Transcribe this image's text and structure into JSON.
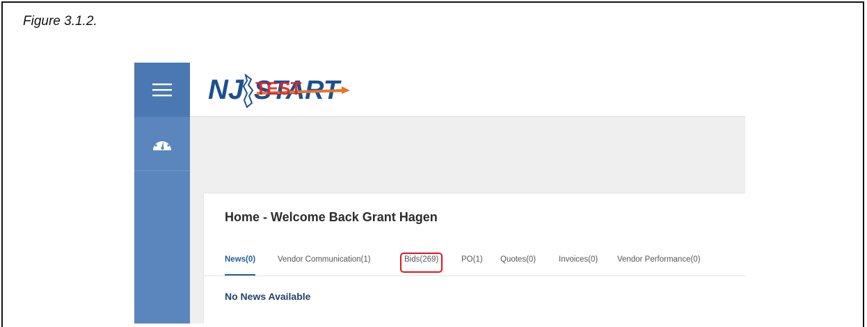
{
  "caption": "Figure 3.1.2.",
  "logo": {
    "brand_left": "NJ",
    "brand_right": "START",
    "overlay": "TEST"
  },
  "sidebar": {
    "items": [
      {
        "icon": "hamburger-menu-icon"
      },
      {
        "icon": "dashboard-gauge-icon"
      }
    ]
  },
  "page": {
    "title": "Home - Welcome Back Grant Hagen"
  },
  "tabs": [
    {
      "label": "News(0)",
      "active": true
    },
    {
      "label": "Vendor Communication(1)"
    },
    {
      "label": "Bids(269)",
      "highlighted": true
    },
    {
      "label": "PO(1)"
    },
    {
      "label": "Quotes(0)"
    },
    {
      "label": "Invoices(0)"
    },
    {
      "label": "Vendor Performance(0)"
    }
  ],
  "news": {
    "empty_message": "No News Available"
  },
  "colors": {
    "sidebar": "#5b86bd",
    "accent": "#1f5e9c",
    "highlight": "#e0141f",
    "logo_orange": "#e5762b",
    "logo_blue": "#1c4f8e"
  }
}
